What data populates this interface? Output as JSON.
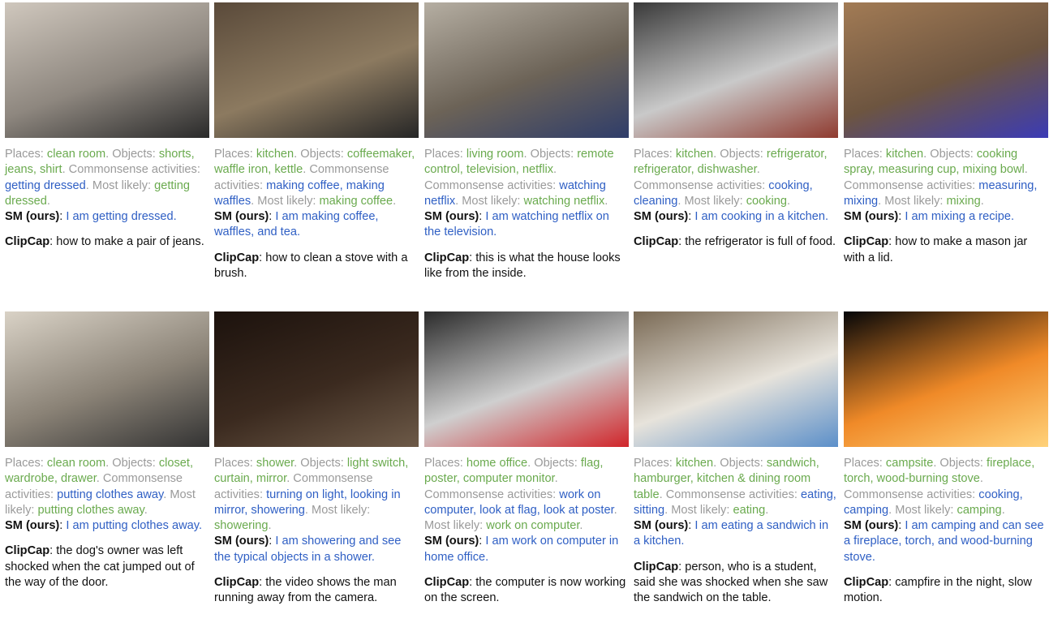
{
  "cells": [
    {
      "id": "r1c1",
      "image": {
        "desc": "carpet-with-game-controller",
        "colors": [
          "#cfc7bd",
          "#8e877f",
          "#2a2a2a"
        ]
      },
      "places": "clean room",
      "objects": "shorts, jeans, shirt",
      "activities": "getting dressed",
      "likely": "getting dressed",
      "sm": "I am getting dressed.",
      "clipcap": "how to make a pair of jeans."
    },
    {
      "id": "r1c2",
      "image": {
        "desc": "kitchen-counter-waffle-iron",
        "colors": [
          "#5a4a3a",
          "#8c7a60",
          "#262626"
        ]
      },
      "places": "kitchen",
      "objects": "coffeemaker, waffle iron, kettle",
      "activities": "making coffee, making waffles",
      "likely": "making coffee",
      "sm": "I am making coffee, waffles, and tea.",
      "clipcap": "how to clean a stove with a brush."
    },
    {
      "id": "r1c3",
      "image": {
        "desc": "living-room-television",
        "colors": [
          "#b5aea2",
          "#6c6357",
          "#2f3d6a"
        ]
      },
      "places": "living room",
      "objects": "remote control, television, netflix",
      "activities": "watching netflix",
      "likely": "watching netflix",
      "sm": "I am watching netflix on the television.",
      "clipcap": "this is what the house looks like from the inside."
    },
    {
      "id": "r1c4",
      "image": {
        "desc": "open-refrigerator",
        "colors": [
          "#3a3a3a",
          "#c9c9c9",
          "#8f3a2f"
        ]
      },
      "places": "kitchen",
      "objects": "refrigerator, refrigerator, dishwasher",
      "activities": "cooking, cleaning",
      "likely": "cooking",
      "sm": "I am cooking in a kitchen.",
      "clipcap": "the refrigerator is full of food."
    },
    {
      "id": "r1c5",
      "image": {
        "desc": "mixing-bowl-on-counter",
        "colors": [
          "#a27b55",
          "#6d5540",
          "#3b3bb5"
        ]
      },
      "places": "kitchen",
      "objects": "cooking spray, measuring cup, mixing bowl",
      "activities": "measuring, mixing",
      "likely": "mixing",
      "sm": "I am mixing a recipe.",
      "clipcap": "how to make a mason jar with a lid."
    },
    {
      "id": "r2c1",
      "image": {
        "desc": "room-doorway-wardrobe",
        "colors": [
          "#d9d2c6",
          "#8a8276",
          "#333333"
        ]
      },
      "places": "clean room",
      "objects": "closet, wardrobe, drawer",
      "activities": "putting clothes away",
      "likely": "putting clothes away",
      "sm": "I am putting clothes away.",
      "clipcap": "the dog's owner was left shocked when the cat jumped out of the way of the door."
    },
    {
      "id": "r2c2",
      "image": {
        "desc": "dark-shower-blur",
        "colors": [
          "#1c120d",
          "#3b2a1f",
          "#6d5a48"
        ]
      },
      "places": "shower",
      "objects": "light switch, curtain, mirror",
      "activities": "turning on light, looking in mirror, showering",
      "likely": "showering",
      "sm": "I am showering and see the typical objects in a shower.",
      "clipcap": "the video shows the man running away from the camera."
    },
    {
      "id": "r2c3",
      "image": {
        "desc": "home-office-laptop-flag",
        "colors": [
          "#2b2b2b",
          "#cfcfcf",
          "#d0252a"
        ]
      },
      "places": "home office",
      "objects": "flag, poster, computer monitor",
      "activities": "work on computer, look at flag, look at poster",
      "likely": "work on computer",
      "sm": "I am work on computer in home office.",
      "clipcap": "the computer is now working on the screen."
    },
    {
      "id": "r2c4",
      "image": {
        "desc": "plate-with-sandwich-on-table",
        "colors": [
          "#7a6a55",
          "#e7e3db",
          "#5b8fc9"
        ]
      },
      "places": "kitchen",
      "objects": "sandwich, hamburger, kitchen & dining room table",
      "activities": "eating, sitting",
      "likely": "eating",
      "sm": "I am eating a sandwich in a kitchen.",
      "clipcap": "person, who is a student, said she was shocked when she saw the sandwich on the table."
    },
    {
      "id": "r2c5",
      "image": {
        "desc": "campfire-at-night",
        "colors": [
          "#050608",
          "#f08a28",
          "#ffd27a"
        ]
      },
      "places": "campsite",
      "objects": "fireplace, torch, wood-burning stove",
      "activities": "cooking, camping",
      "likely": "camping",
      "sm": "I am camping and can see a fireplace, torch, and wood-burning stove.",
      "clipcap": "campfire in the night, slow motion."
    }
  ],
  "labels": {
    "places": "Places: ",
    "objects": "Objects: ",
    "activities": "Commonsense activities: ",
    "likely": "Most likely: ",
    "sm": "SM (ours)",
    "clipcap": "ClipCap"
  }
}
